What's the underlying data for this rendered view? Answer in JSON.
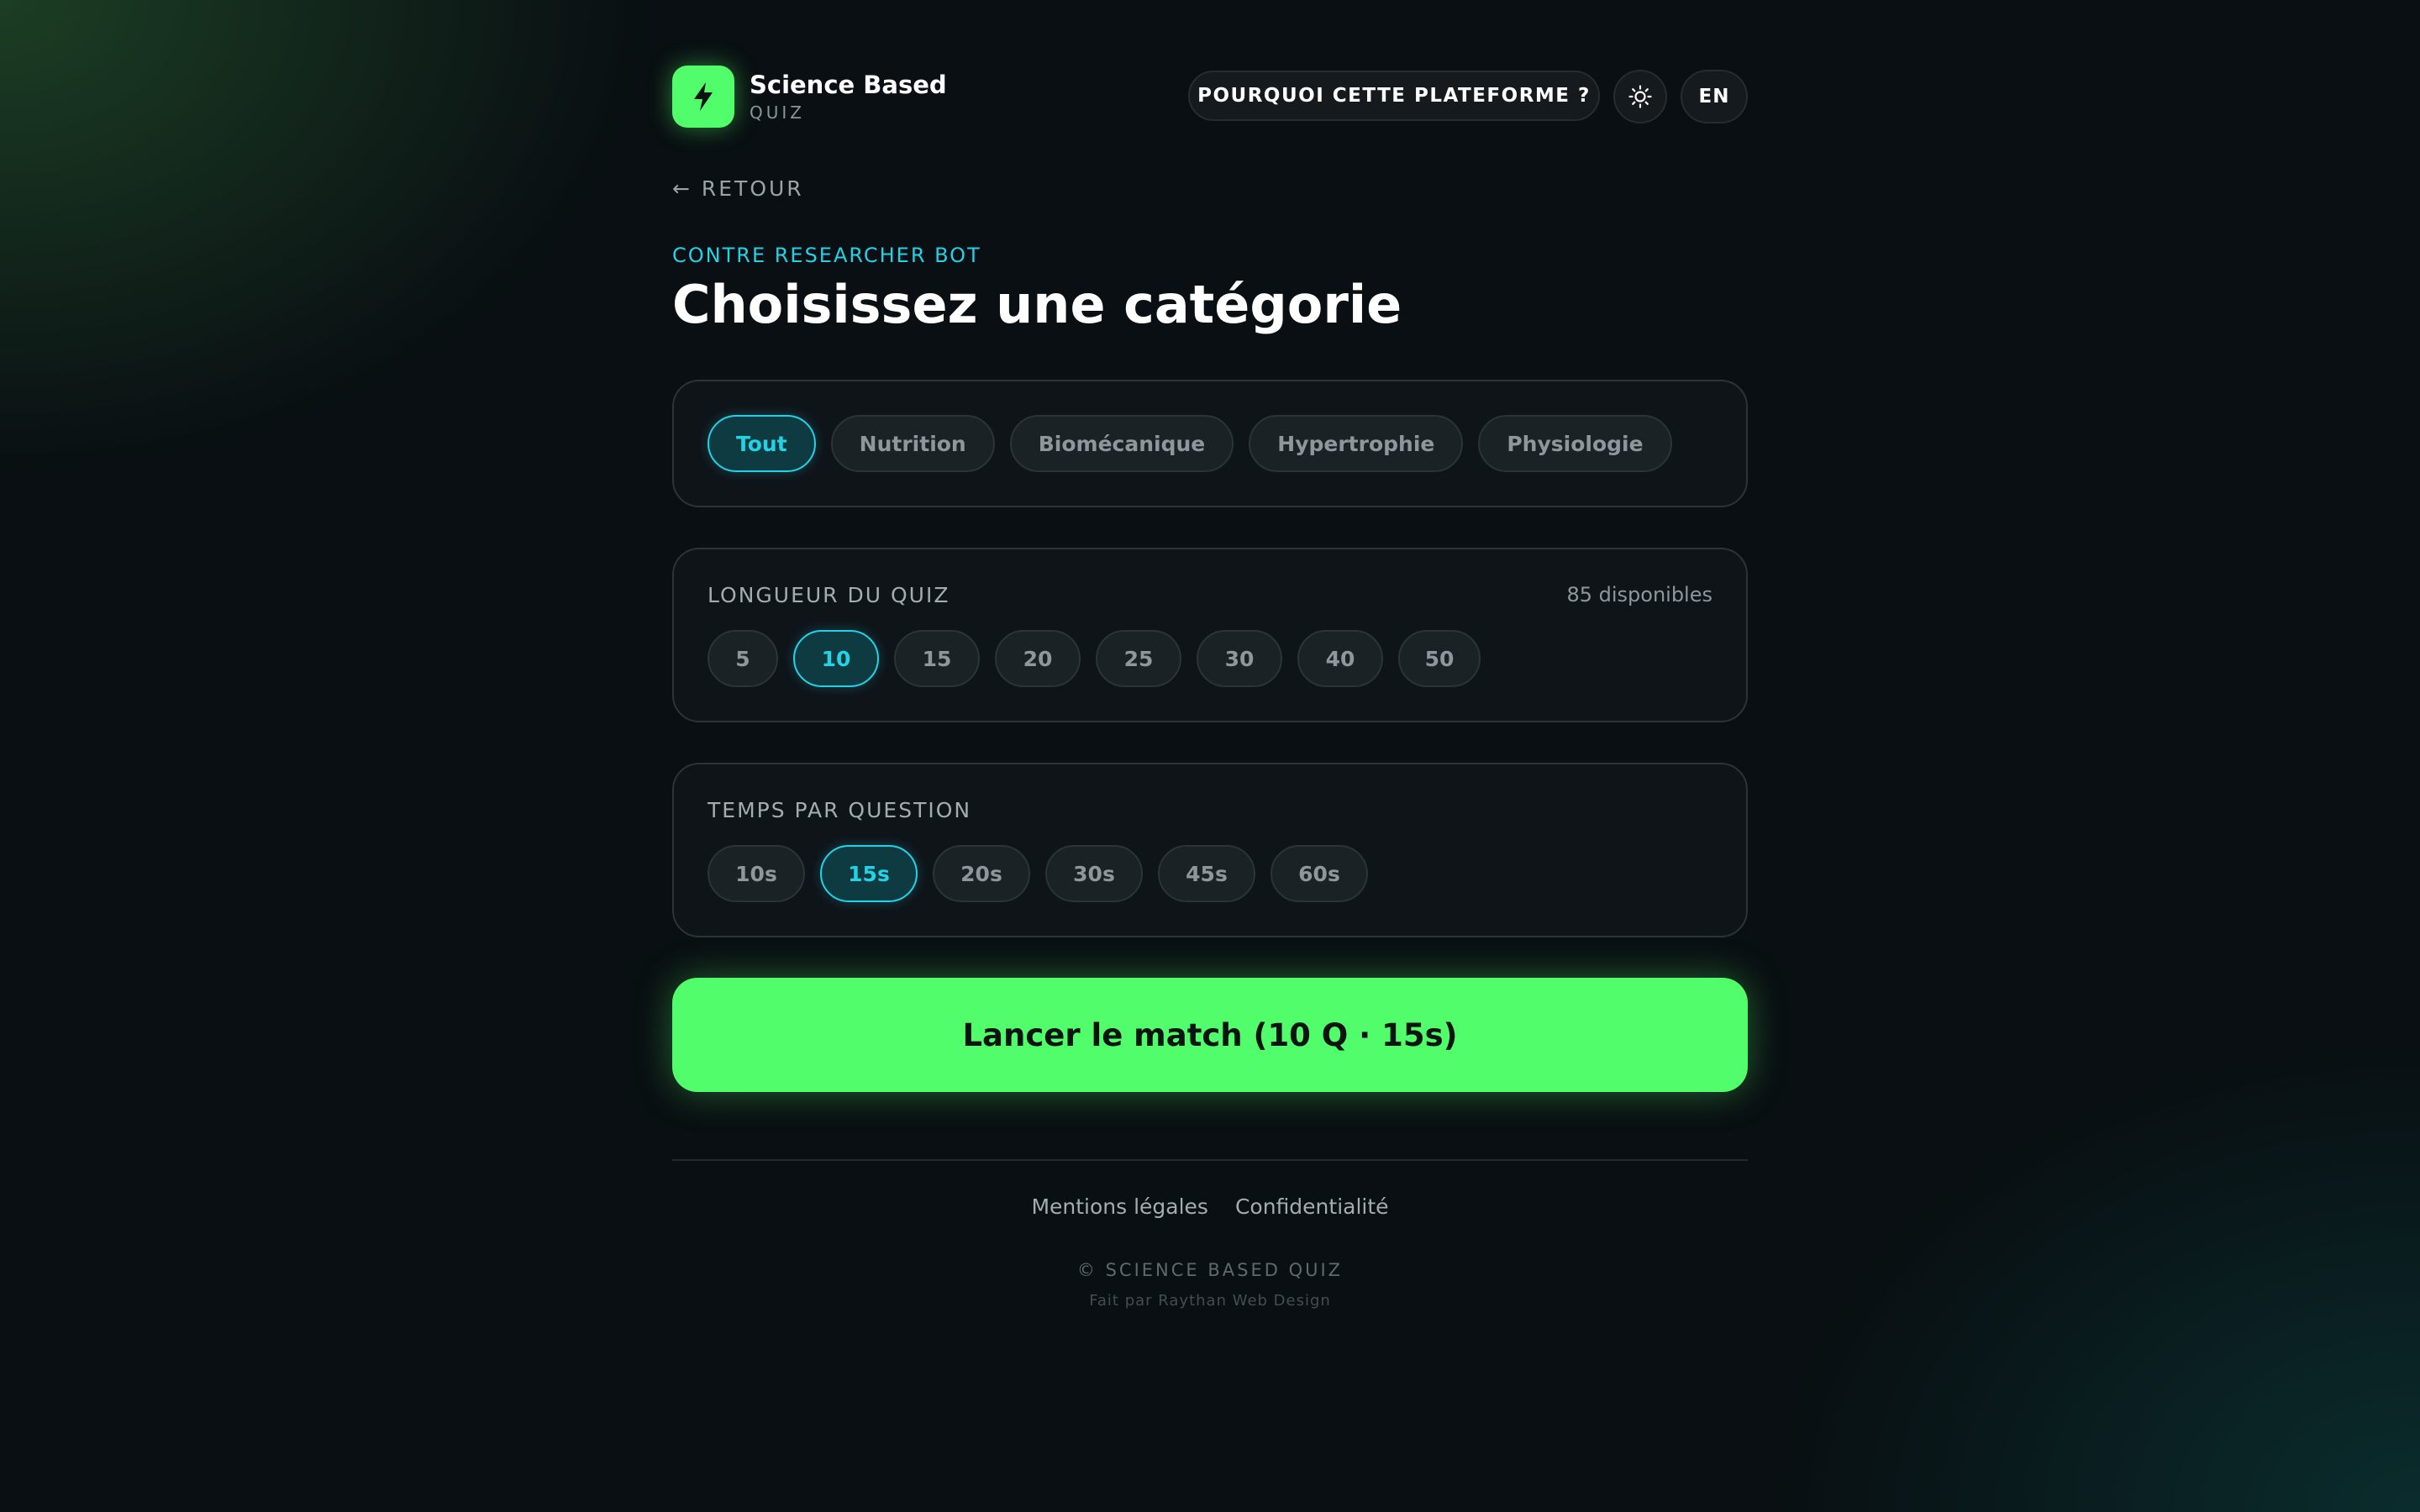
{
  "brand": {
    "title": "Science Based",
    "subtitle": "QUIZ",
    "accent_color": "#52fd6b"
  },
  "header": {
    "why_label": "POURQUOI CETTE PLATEFORME ?",
    "theme_icon": "sun-icon",
    "lang_label": "EN"
  },
  "nav": {
    "back_label": "← RETOUR"
  },
  "page": {
    "eyebrow": "CONTRE RESEARCHER BOT",
    "title": "Choisissez une catégorie"
  },
  "categories": {
    "items": [
      "Tout",
      "Nutrition",
      "Biomécanique",
      "Hypertrophie",
      "Physiologie"
    ],
    "selected": "Tout"
  },
  "quiz_length": {
    "label": "LONGUEUR DU QUIZ",
    "available": "85 disponibles",
    "options": [
      "5",
      "10",
      "15",
      "20",
      "25",
      "30",
      "40",
      "50"
    ],
    "selected": "10"
  },
  "time_per_question": {
    "label": "TEMPS PAR QUESTION",
    "options": [
      "10s",
      "15s",
      "20s",
      "30s",
      "45s",
      "60s"
    ],
    "selected": "15s"
  },
  "launch": {
    "label": "Lancer le match (10 Q · 15s)"
  },
  "footer": {
    "links": [
      "Mentions légales",
      "Confidentialité"
    ],
    "copyright": "© SCIENCE BASED QUIZ",
    "credit": "Fait par Raythan Web Design"
  },
  "colors": {
    "active": "#22d3e6",
    "background": "#090f12"
  }
}
